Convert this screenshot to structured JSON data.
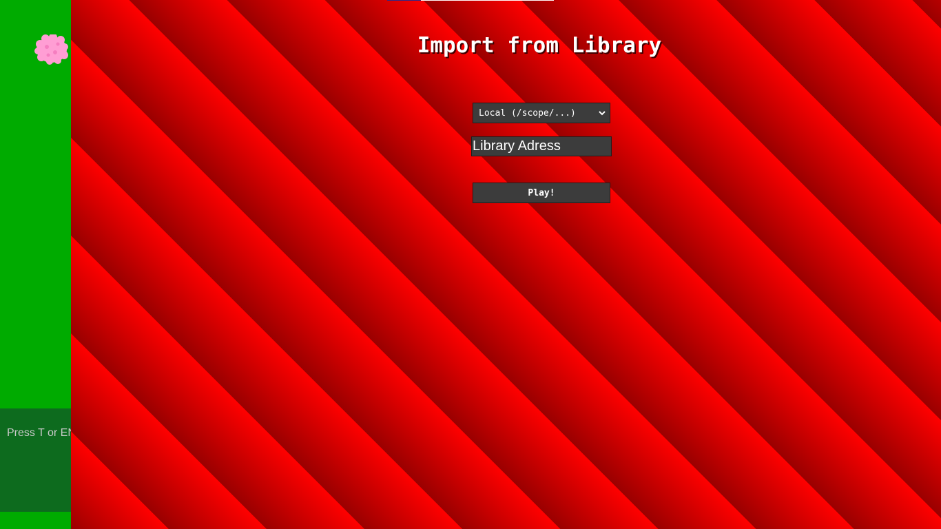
{
  "page": {
    "title": "Import from Library"
  },
  "source_select": {
    "selected": "Local (/scope/...)"
  },
  "address_input": {
    "value": "",
    "placeholder": "Library Adress"
  },
  "play_button": {
    "label": "Play!"
  },
  "chat": {
    "hint": "Press T or ENTER to chat"
  },
  "icons": {
    "avatar": "pink-fluff-icon",
    "select_arrow": "chevron-down-icon"
  },
  "colors": {
    "sidebar": "#00ab00",
    "chat_box": "#0d6b1e",
    "stripe_dark": "#9a0000",
    "stripe_light": "#ff0000",
    "control_bg": "#3c3c3c"
  }
}
